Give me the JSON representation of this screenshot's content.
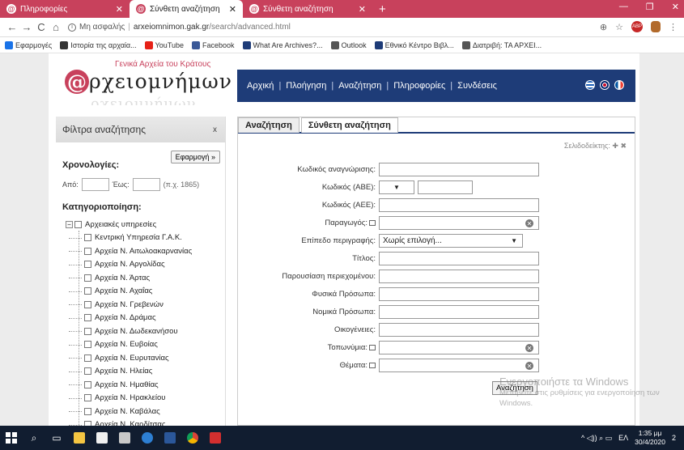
{
  "browser": {
    "tabs": [
      {
        "title": "Πληροφορίες",
        "active": false
      },
      {
        "title": "Σύνθετη αναζήτηση",
        "active": true
      },
      {
        "title": "Σύνθετη αναζήτηση",
        "active": false
      }
    ],
    "new_tab": "+",
    "window_controls": {
      "minimize": "—",
      "maximize": "❐",
      "close": "✕"
    },
    "nav": {
      "back": "←",
      "forward": "→",
      "reload": "C",
      "home": "⌂"
    },
    "security_label": "Μη ασφαλής",
    "url_host": "arxeiomnimon.gak.gr",
    "url_path": "/search/advanced.html",
    "toolbar": {
      "zoom": "⊕",
      "star": "☆",
      "abp": "ABP",
      "menu": "⋮"
    },
    "bookmarks": [
      {
        "label": "Εφαρμογές",
        "color": "#1a73e8"
      },
      {
        "label": "Ιστορία της αρχαία...",
        "color": "#333333"
      },
      {
        "label": "YouTube",
        "color": "#e62117"
      },
      {
        "label": "Facebook",
        "color": "#3b5998"
      },
      {
        "label": "What Are Archives?...",
        "color": "#1e3c78"
      },
      {
        "label": "Outlook",
        "color": "#555555"
      },
      {
        "label": "Εθνικό Κέντρο Βιβλ...",
        "color": "#1e3c78"
      },
      {
        "label": "Διατριβή: ΤΑ ΑΡΧΕΙ...",
        "color": "#555555"
      }
    ]
  },
  "site": {
    "logo_subtitle": "Γενικά Αρχεία του Κράτους",
    "logo_at": "@",
    "logo_word": "ρχειομνήμων",
    "nav_items": [
      "Αρχική",
      "Πλοήγηση",
      "Αναζήτηση",
      "Πληροφορίες",
      "Συνδέσεις"
    ],
    "nav_separator": "|"
  },
  "sidebar": {
    "title": "Φίλτρα αναζήτησης",
    "close": "x",
    "apply_label": "Εφαρμογή »",
    "chronology_title": "Χρονολογίες:",
    "from_label": "Από:",
    "to_label": "Έως:",
    "year_hint": "(π.χ. 1865)",
    "categorization_title": "Κατηγοριοποίηση:",
    "tree_root": "Αρχειακές υπηρεσίες",
    "tree_children": [
      "Κεντρική Υπηρεσία Γ.Α.Κ.",
      "Αρχεία Ν. Αιτωλοακαρνανίας",
      "Αρχεία Ν. Αργολίδας",
      "Αρχεία Ν. Άρτας",
      "Αρχεία Ν. Αχαΐας",
      "Αρχεία Ν. Γρεβενών",
      "Αρχεία Ν. Δράμας",
      "Αρχεία Ν. Δωδεκανήσου",
      "Αρχεία Ν. Ευβοίας",
      "Αρχεία Ν. Ευρυτανίας",
      "Αρχεία Ν. Ηλείας",
      "Αρχεία Ν. Ημαθίας",
      "Αρχεία Ν. Ηρακλείου",
      "Αρχεία Ν. Καβάλας",
      "Αρχεία Ν. Καρδίτσας"
    ]
  },
  "main": {
    "tabs": [
      "Αναζήτηση",
      "Σύνθετη αναζήτηση"
    ],
    "bookmarks_label": "Σελιδοδείκτης:",
    "bookmarks_icons": "✚ ✖",
    "fields": {
      "id_code": "Κωδικός αναγνώρισης:",
      "abe_code": "Κωδικός (ΑΒΕ):",
      "aee_code": "Κωδικός (ΑΕΕ):",
      "producer": "Παραγωγός:",
      "level": "Επίπεδο περιγραφής:",
      "title": "Τίτλος:",
      "scope": "Παρουσίαση περιεχομένου:",
      "persons": "Φυσικά Πρόσωπα:",
      "legal": "Νομικά Πρόσωπα:",
      "families": "Οικογένειες:",
      "places": "Τοπωνύμια:",
      "subjects": "Θέματα:"
    },
    "abe_select_arrow": "▼",
    "level_value": "Χωρίς επιλογή...",
    "level_arrow": "▼",
    "clear_glyph": "✕",
    "search_button": "Αναζήτηση"
  },
  "watermark": {
    "line1": "Ενεργοποιήστε τα Windows",
    "line2": "Μεταβείτε στις ρυθμίσεις για ενεργοποίηση των",
    "line3": "Windows."
  },
  "taskbar": {
    "tray_icons": "^ ◁)) ⌕ ▭",
    "lang": "ΕΛ",
    "time": "1:35 μμ",
    "date": "30/4/2020",
    "notif": "2"
  }
}
